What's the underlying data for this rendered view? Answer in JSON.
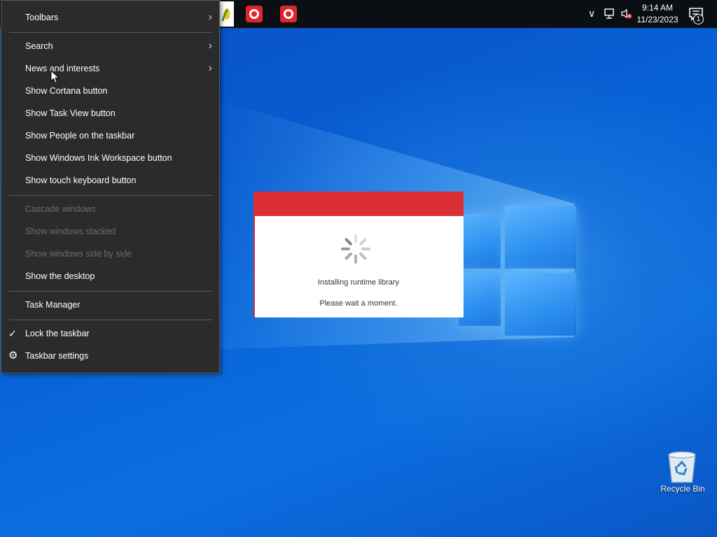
{
  "context_menu": {
    "items": [
      {
        "label": "Toolbars",
        "submenu": true,
        "enabled": true
      },
      {
        "label": "Search",
        "submenu": true,
        "enabled": true
      },
      {
        "label": "News and interests",
        "submenu": true,
        "enabled": true
      },
      {
        "label": "Show Cortana button",
        "enabled": true
      },
      {
        "label": "Show Task View button",
        "enabled": true
      },
      {
        "label": "Show People on the taskbar",
        "enabled": true
      },
      {
        "label": "Show Windows Ink Workspace button",
        "enabled": true
      },
      {
        "label": "Show touch keyboard button",
        "enabled": true
      },
      {
        "label": "Cascade windows",
        "enabled": false
      },
      {
        "label": "Show windows stacked",
        "enabled": false
      },
      {
        "label": "Show windows side by side",
        "enabled": false
      },
      {
        "label": "Show the desktop",
        "enabled": true
      },
      {
        "label": "Task Manager",
        "enabled": true
      },
      {
        "label": "Lock the taskbar",
        "enabled": true,
        "checked": true
      },
      {
        "label": "Taskbar settings",
        "enabled": true,
        "icon": "gear-icon"
      }
    ],
    "arrow_glyph": "›",
    "check_glyph": "✓",
    "gear_glyph": "⚙"
  },
  "taskbar": {
    "time": "9:14 AM",
    "date": "11/23/2023",
    "notification_count": "1",
    "apps": [
      {
        "name": "partial-app-icon",
        "icon": "corn-icon"
      },
      {
        "name": "installer-app",
        "icon": "red-app-icon"
      },
      {
        "name": "installer-app-2",
        "icon": "red-app-icon"
      }
    ],
    "tray_chevron": "∨"
  },
  "dialog": {
    "status": "Installing runtime library",
    "message": "Please wait a moment.",
    "accent": "#dc2f33"
  },
  "desktop": {
    "recycle_bin_label": "Recycle Bin"
  }
}
